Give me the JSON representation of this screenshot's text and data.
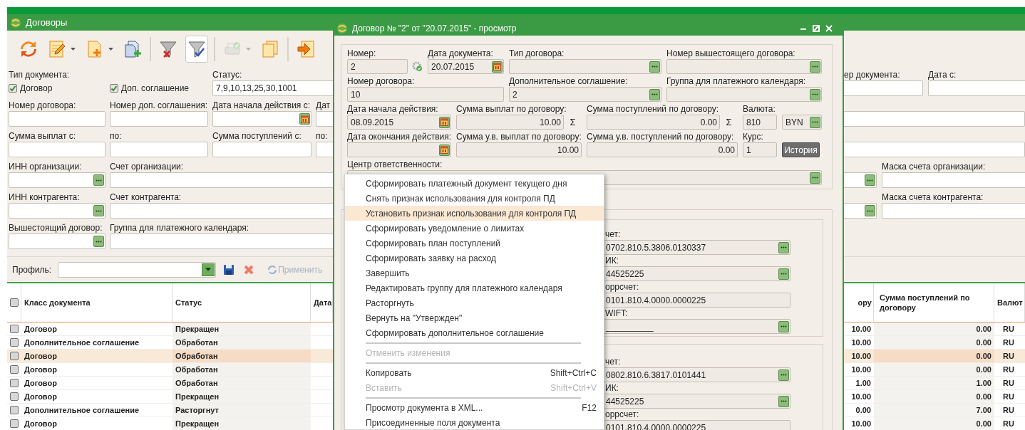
{
  "main_window": {
    "title": "Договоры"
  },
  "toolbar": [
    {
      "kind": "refresh",
      "pressed": false,
      "disabled": false,
      "dropdown": false
    },
    {
      "kind": "edit",
      "pressed": false,
      "disabled": false,
      "dropdown": true
    },
    {
      "kind": "new",
      "pressed": false,
      "disabled": false,
      "dropdown": true
    },
    {
      "kind": "add",
      "pressed": false,
      "disabled": false,
      "dropdown": false
    },
    {
      "kind": "separator"
    },
    {
      "kind": "filter_clear",
      "pressed": false,
      "disabled": false,
      "dropdown": false
    },
    {
      "kind": "filter_apply",
      "pressed": true,
      "disabled": false,
      "dropdown": false
    },
    {
      "kind": "separator"
    },
    {
      "kind": "print",
      "pressed": false,
      "disabled": true,
      "dropdown": true
    },
    {
      "kind": "copy",
      "pressed": false,
      "disabled": false,
      "dropdown": false
    },
    {
      "kind": "separator"
    },
    {
      "kind": "exit",
      "pressed": false,
      "disabled": false,
      "dropdown": false
    }
  ],
  "filters": {
    "doc_type_label": "Тип документа:",
    "doc_types": [
      {
        "label": "Договор",
        "checked": true
      },
      {
        "label": "Доп. соглашение",
        "checked": true
      }
    ],
    "status": {
      "label": "Статус:",
      "value": "7,9,10,13,25,30,1001"
    },
    "rows": [
      [
        {
          "label": "Номер договора:",
          "kind": "text"
        },
        {
          "label": "Номер доп. соглашения:",
          "kind": "text"
        },
        {
          "label": "Дата начала действия с:",
          "kind": "date"
        },
        {
          "label": "Дат",
          "kind": "text"
        }
      ],
      [
        {
          "label": "Сумма выплат с:",
          "kind": "text"
        },
        {
          "label": "по:",
          "kind": "text"
        },
        {
          "label": "Сумма поступлений с:",
          "kind": "text"
        },
        {
          "label": "по:",
          "kind": "text"
        }
      ],
      [
        {
          "label": "ИНН организации:",
          "kind": "lookup"
        },
        {
          "label": "Счет организации:",
          "kind": "text"
        }
      ],
      [
        {
          "label": "ИНН контрагента:",
          "kind": "lookup"
        },
        {
          "label": "Счет контрагента:",
          "kind": "text"
        }
      ],
      [
        {
          "label": "Вышестоящий договор:",
          "kind": "lookup"
        },
        {
          "label": "Группа для платежного календаря:",
          "kind": "text"
        }
      ]
    ],
    "right_rows": [
      [
        {
          "label": "ер документа:",
          "kind": "text"
        },
        {
          "label": "Дата с:",
          "kind": "text"
        }
      ],
      [
        {
          "kind": "text"
        }
      ],
      [
        {
          "kind": "text"
        }
      ],
      [
        {
          "kind": "lookup"
        },
        {
          "label": "Маска счета организации:",
          "kind": "text"
        }
      ],
      [
        {
          "kind": "lookup"
        },
        {
          "label": "Маска счета контрагента:",
          "kind": "text"
        }
      ]
    ]
  },
  "profile": {
    "label": "Профиль:",
    "apply_label": "Применить",
    "apply_disabled": true
  },
  "table": {
    "header_checked": false,
    "columns": [
      "Класс документа",
      "Статус",
      "Дата",
      "ору",
      "Сумма поступлений по договору",
      "Валют"
    ],
    "rows": [
      {
        "checked": false,
        "selected": false,
        "cells": [
          "Договор",
          "Прекращен",
          "",
          "10.00",
          "0.00",
          "RU"
        ]
      },
      {
        "checked": false,
        "selected": false,
        "cells": [
          "Дополнительное соглашение",
          "Обработан",
          "",
          "10.00",
          "0.00",
          "RU"
        ]
      },
      {
        "checked": false,
        "selected": true,
        "cells": [
          "Договор",
          "Обработан",
          "",
          "10.00",
          "0.00",
          "RU"
        ]
      },
      {
        "checked": false,
        "selected": false,
        "cells": [
          "Договор",
          "Обработан",
          "",
          "10.00",
          "0.00",
          "RU"
        ]
      },
      {
        "checked": false,
        "selected": false,
        "cells": [
          "Договор",
          "Обработан",
          "",
          "1.00",
          "1.00",
          "RU"
        ]
      },
      {
        "checked": false,
        "selected": false,
        "cells": [
          "Договор",
          "Прекращен",
          "",
          "10.00",
          "0.00",
          "RU"
        ]
      },
      {
        "checked": false,
        "selected": false,
        "cells": [
          "Дополнительное соглашение",
          "Расторгнут",
          "",
          "0.00",
          "7.00",
          "RU"
        ]
      },
      {
        "checked": false,
        "selected": false,
        "cells": [
          "Договор",
          "Прекращен",
          "",
          "10.00",
          "0.00",
          "RU"
        ]
      }
    ]
  },
  "dialog": {
    "title": "Договор № \"2\" от \"20.07.2015\" - просмотр",
    "fields": [
      {
        "label": "Номер:",
        "value": "2",
        "kind": "autonumber"
      },
      {
        "label": "Дата документа:",
        "value": "20.07.2015",
        "kind": "date"
      },
      {
        "label": "Тип договора:",
        "kind": "lookup"
      },
      {
        "label": "Номер вышестоящего договора:",
        "kind": "lookup"
      },
      {
        "label": "Номер договора:",
        "value": "10",
        "kind": "text"
      },
      {
        "label": "Дополнительное соглашение:",
        "value": "2",
        "kind": "lookup"
      },
      {
        "label": "Группа для платежного календаря:",
        "kind": "lookup"
      },
      {
        "label": "Дата начала действия:",
        "value": "08.09.2015",
        "kind": "date"
      },
      {
        "label": "Сумма выплат по договору:",
        "value": "10.00",
        "kind": "sum",
        "suffix": "Σ"
      },
      {
        "label": "Сумма поступлений по договору:",
        "value": "0.00",
        "kind": "sum",
        "suffix": "Σ"
      },
      {
        "label": "Валюта:",
        "value": "810",
        "kind": "text"
      },
      {
        "value": "BYN",
        "kind": "lookup"
      },
      {
        "label": "Дата окончания действия:",
        "kind": "date"
      },
      {
        "label": "Сумма у.в. выплат по договору:",
        "value": "10.00",
        "kind": "amount"
      },
      {
        "label": "Сумма у.в. поступлений по договору:",
        "value": "0.00",
        "kind": "amount"
      },
      {
        "label": "Курс:",
        "value": "1",
        "kind": "text"
      },
      {
        "label": "История",
        "kind": "button"
      },
      {
        "label": "Центр ответственности:",
        "kind": "lookup"
      }
    ],
    "accounts": [
      [
        {
          "label": "чет:",
          "value": "0702.810.5.3806.0130337",
          "kind": "lookup"
        },
        {
          "label": "ИК:",
          "value": "44525225",
          "kind": "lookup"
        },
        {
          "label": "оррсчет:",
          "value": "0101.810.4.0000.0000225",
          "kind": "text"
        },
        {
          "label": "WIFT:",
          "value": "__________",
          "kind": "lookup"
        }
      ],
      [
        {
          "label": "чет:",
          "value": "0802.810.6.3817.0101441",
          "kind": "lookup"
        },
        {
          "label": "ИК:",
          "value": "44525225",
          "kind": "lookup"
        },
        {
          "label": "оррсчет:",
          "value": "0101.810.4.0000.0000225",
          "kind": "text"
        }
      ]
    ]
  },
  "context_menu": [
    {
      "kind": "item",
      "label": "Сформировать платежный документ текущего дня",
      "disabled": false,
      "selected": false
    },
    {
      "kind": "item",
      "label": "Снять признак использования для контроля ПД",
      "disabled": false,
      "selected": false
    },
    {
      "kind": "item",
      "label": "Установить признак использования для контроля ПД",
      "disabled": false,
      "selected": true
    },
    {
      "kind": "item",
      "label": "Сформировать уведомление о лимитах",
      "disabled": false,
      "selected": false
    },
    {
      "kind": "item",
      "label": "Сформировать план поступлений",
      "disabled": false,
      "selected": false
    },
    {
      "kind": "item",
      "label": "Сформировать заявку на расход",
      "disabled": false,
      "selected": false
    },
    {
      "kind": "item",
      "label": "Завершить",
      "disabled": false,
      "selected": false
    },
    {
      "kind": "item",
      "label": "Редактировать группу для платежного календаря",
      "disabled": false,
      "selected": false
    },
    {
      "kind": "item",
      "label": "Расторгнуть",
      "disabled": false,
      "selected": false
    },
    {
      "kind": "item",
      "label": "Вернуть на \"Утвержден\"",
      "disabled": false,
      "selected": false
    },
    {
      "kind": "item",
      "label": "Сформировать дополнительное соглашение",
      "disabled": false,
      "selected": false
    },
    {
      "kind": "separator"
    },
    {
      "kind": "item",
      "label": "Отменить изменения",
      "disabled": true,
      "selected": false
    },
    {
      "kind": "separator"
    },
    {
      "kind": "item",
      "label": "Копировать",
      "shortcut": "Shift+Ctrl+C",
      "disabled": false,
      "selected": false
    },
    {
      "kind": "item",
      "label": "Вставить",
      "shortcut": "Shift+Ctrl+V",
      "disabled": true,
      "selected": false
    },
    {
      "kind": "separator"
    },
    {
      "kind": "item",
      "label": "Просмотр документа в XML...",
      "shortcut": "F12",
      "disabled": false,
      "selected": false
    },
    {
      "kind": "item",
      "label": "Присоединенные поля документа",
      "disabled": false,
      "selected": false
    }
  ]
}
